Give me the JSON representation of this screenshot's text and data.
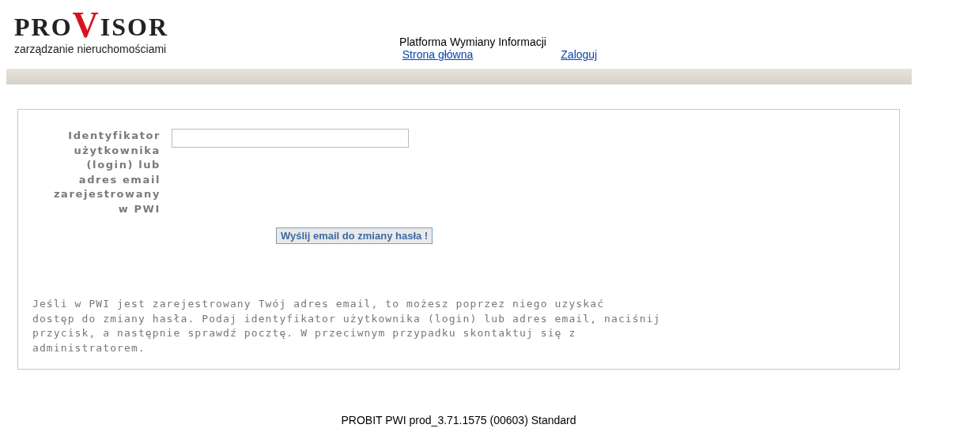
{
  "logo": {
    "before": "PRO",
    "highlight": "V",
    "after": "ISOR",
    "tagline": "zarządzanie nieruchomościami"
  },
  "header": {
    "title": "Platforma Wymiany Informacji",
    "links": [
      "Strona główna",
      "Zaloguj"
    ]
  },
  "form": {
    "label_lines": [
      "Identyfikator",
      "użytkownika",
      "(login) lub",
      "adres email",
      "zarejestrowany",
      "w PWI"
    ],
    "button": "Wyślij email do zmiany hasła !"
  },
  "help_lines": [
    "Jeśli w PWI jest zarejestrowany Twój adres email, to możesz poprzez niego uzyskać",
    "dostęp do zmiany hasła. Podaj identyfikator użytkownika (login) lub adres email, naciśnij",
    "przycisk, a następnie sprawdź pocztę. W przeciwnym przypadku skontaktuj się z",
    "administratorem."
  ],
  "footer": "PROBIT PWI prod_3.71.1575 (00603) Standard"
}
